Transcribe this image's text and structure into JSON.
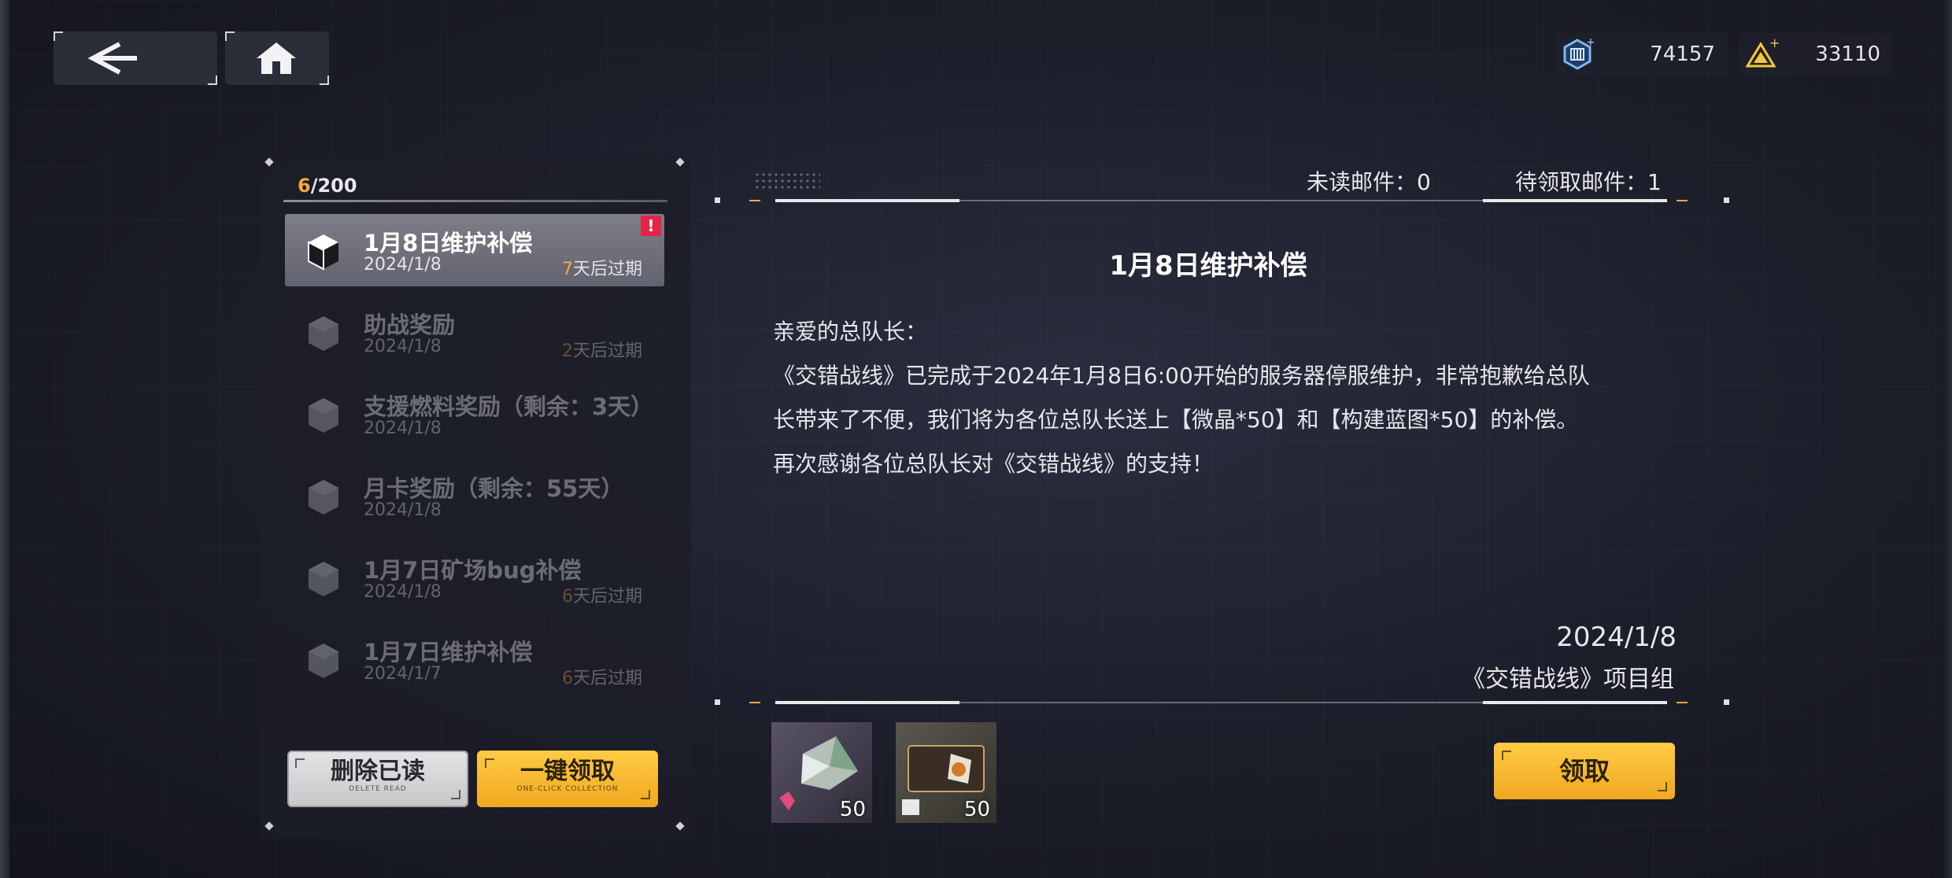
{
  "currencies": [
    {
      "icon": "chip-icon",
      "value": "74157"
    },
    {
      "icon": "triangle-crystal-icon",
      "value": "33110"
    }
  ],
  "mailbox": {
    "count_current": "6",
    "count_total": "/200",
    "items": [
      {
        "title": "1月8日维护补偿",
        "date": "2024/1/8",
        "expire_n": "7",
        "expire_text": "天后过期",
        "badge": "!"
      },
      {
        "title": "助战奖励",
        "date": "2024/1/8",
        "expire_n": "2",
        "expire_text": "天后过期"
      },
      {
        "title": "支援燃料奖励（剩余：3天）",
        "date": "2024/1/8",
        "expire_n": "",
        "expire_text": ""
      },
      {
        "title": "月卡奖励（剩余：55天）",
        "date": "2024/1/8",
        "expire_n": "",
        "expire_text": ""
      },
      {
        "title": "1月7日矿场bug补偿",
        "date": "2024/1/8",
        "expire_n": "6",
        "expire_text": "天后过期"
      },
      {
        "title": "1月7日维护补偿",
        "date": "2024/1/7",
        "expire_n": "6",
        "expire_text": "天后过期"
      }
    ],
    "delete_label": "删除已读",
    "delete_sub": "DELETE READ",
    "collect_all_label": "一键领取",
    "collect_all_sub": "ONE-CLICK COLLECTION"
  },
  "detail": {
    "unread_label": "未读邮件：0",
    "pending_label": "待领取邮件：1",
    "title": "1月8日维护补偿",
    "body": [
      "亲爱的总队长：",
      "《交错战线》已完成于2024年1月8日6:00开始的服务器停服维护，非常抱歉给总队",
      "长带来了不便，我们将为各位总队长送上【微晶*50】和【构建蓝图*50】的补偿。",
      "再次感谢各位总队长对《交错战线》的支持！"
    ],
    "sign_date": "2024/1/8",
    "sign_team": "《交错战线》项目组",
    "rewards": [
      {
        "name": "micro-crystal",
        "qty": "50"
      },
      {
        "name": "build-blueprint",
        "qty": "50"
      }
    ],
    "claim_label": "领取"
  },
  "colors": {
    "accent": "#f3a93c",
    "button_yellow": "#fbbd33",
    "badge_red": "#e4234a"
  }
}
